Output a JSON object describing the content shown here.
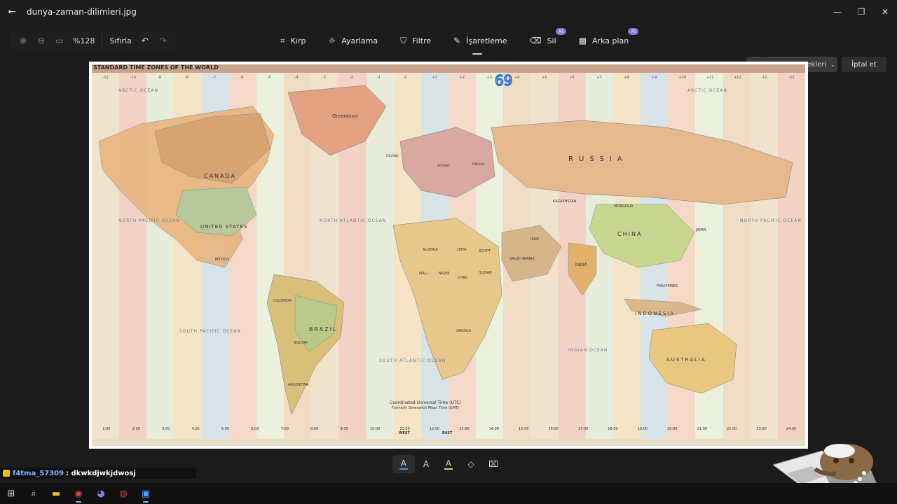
{
  "window": {
    "title": "dunya-zaman-dilimleri.jpg"
  },
  "zoom": {
    "value": "%128",
    "reset_label": "Sıfırla"
  },
  "tools": [
    {
      "label": "Kırp",
      "icon": "crop-icon",
      "ai": ""
    },
    {
      "label": "Ayarlama",
      "icon": "brightness-icon",
      "ai": ""
    },
    {
      "label": "Filtre",
      "icon": "filter-icon",
      "ai": ""
    },
    {
      "label": "İşaretleme",
      "icon": "markup-pen-icon",
      "ai": ""
    },
    {
      "label": "Sil",
      "icon": "erase-icon",
      "ai": "AI"
    },
    {
      "label": "Arka plan",
      "icon": "background-icon",
      "ai": "AI"
    }
  ],
  "actions": {
    "save_label": "Kaydetme seçenekleri",
    "cancel_label": "İptal et"
  },
  "map": {
    "title": "STANDARD TIME ZONES OF THE WORLD",
    "oceans": [
      "ARCTIC OCEAN",
      "ARCTIC OCEAN",
      "NORTH PACIFIC OCEAN",
      "NORTH ATLANTIC OCEAN",
      "SOUTH PACIFIC OCEAN",
      "SOUTH ATLANTIC OCEAN",
      "INDIAN OCEAN",
      "NORTH PACIFIC OCEAN"
    ],
    "countries": [
      "CANADA",
      "UNITED STATES",
      "RUSSIA",
      "CHINA",
      "BRAZIL",
      "INDONESIA",
      "AUSTRALIA",
      "Greenland",
      "KAZAKHSTAN",
      "MONGOLIA",
      "INDIA",
      "ALGERIA",
      "LIBYA",
      "EGYPT",
      "SUDAN",
      "CHAD",
      "NIGER",
      "MALI",
      "ANGOLA",
      "SAUDI ARABIA",
      "IRAN",
      "ARGENTINA",
      "COLOMBIA",
      "BOLIVIA",
      "MEXICO",
      "PHILIPPINES",
      "JAPAN",
      "ICELAND",
      "FINLAND",
      "NORWAY"
    ],
    "top_zones": [
      "-11",
      "-10",
      "-9",
      "-8",
      "-7",
      "-6",
      "-5",
      "-4",
      "-3",
      "-2",
      "-1",
      "0",
      "+1",
      "+2",
      "+3",
      "+4",
      "+5",
      "+6",
      "+7",
      "+8",
      "+9",
      "+10",
      "+11",
      "+12",
      "-12",
      "-11"
    ],
    "bottom_times": [
      "1:00",
      "2:00",
      "3:00",
      "4:00",
      "5:00",
      "6:00",
      "7:00",
      "8:00",
      "9:00",
      "10:00",
      "11:00",
      "12:00",
      "13:00",
      "14:00",
      "15:00",
      "16:00",
      "17:00",
      "18:00",
      "19:00",
      "20:00",
      "21:00",
      "22:00",
      "23:00",
      "24:00"
    ],
    "utc_caption": "Coordinated Universal Time (UTC)",
    "utc_caption2": "Formerly Greenwich Mean Time (GMT)",
    "west_label": "WEST",
    "east_label": "EAST",
    "annotation": "69"
  },
  "chat": {
    "user": "f4tma_57309",
    "message": ": dkwkdjwkjdwosj"
  },
  "colors": {
    "accent": "#8f6fd8",
    "background": "#1c1c1c"
  }
}
